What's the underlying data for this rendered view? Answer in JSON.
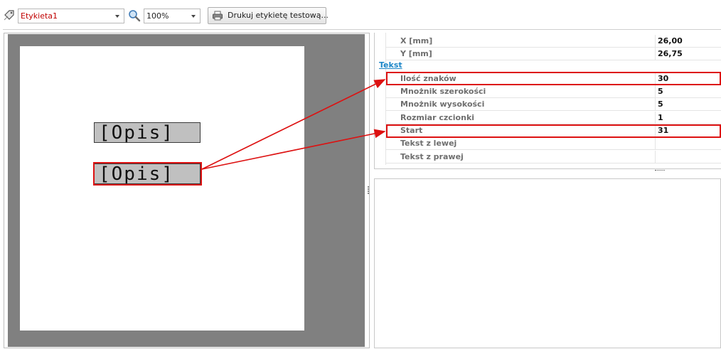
{
  "toolbar": {
    "label_select": {
      "value": "Etykieta1",
      "icon": "tag-icon"
    },
    "zoom_select": {
      "value": "100%",
      "icon": "magnifier-icon"
    },
    "print_button": {
      "label": "Drukuj etykietę testową...",
      "icon": "printer-icon"
    }
  },
  "canvas": {
    "fields": [
      {
        "text": "[Opis]"
      },
      {
        "text": "[Opis]"
      }
    ]
  },
  "properties": {
    "rows_top": [
      {
        "name": "X [mm]",
        "value": "26,00"
      },
      {
        "name": "Y [mm]",
        "value": "26,75"
      }
    ],
    "category": "Tekst",
    "rows_tekst": [
      {
        "name": "Ilość znaków",
        "value": "30"
      },
      {
        "name": "Mnożnik szerokości",
        "value": "5"
      },
      {
        "name": "Mnożnik wysokości",
        "value": "5"
      },
      {
        "name": "Rozmiar czcionki",
        "value": "1"
      },
      {
        "name": "Start",
        "value": "31"
      },
      {
        "name": "Tekst z lewej",
        "value": ""
      },
      {
        "name": "Tekst z prawej",
        "value": ""
      }
    ]
  },
  "annotations": {
    "color": "#dd1111"
  }
}
